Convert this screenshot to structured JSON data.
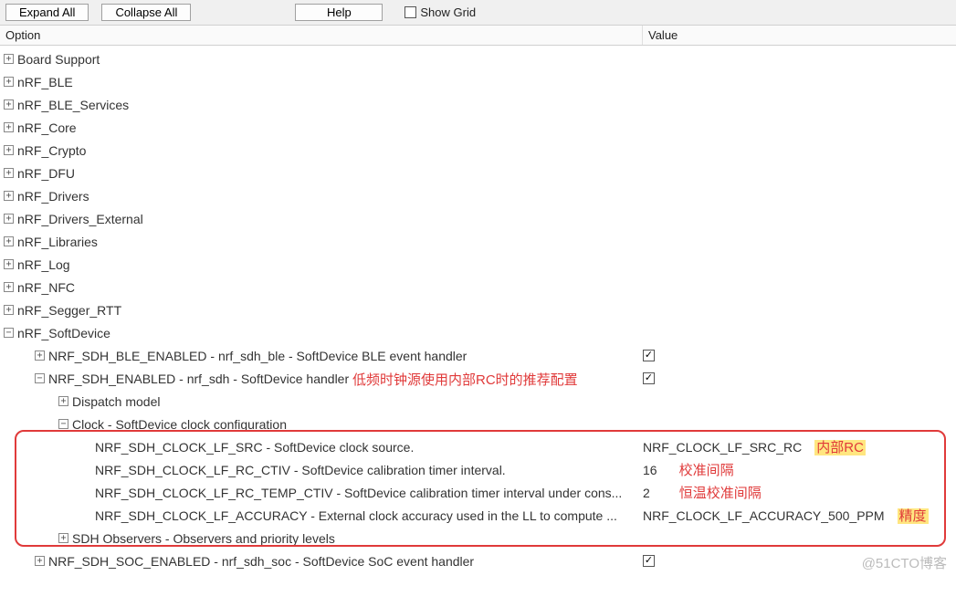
{
  "toolbar": {
    "expand_all": "Expand All",
    "collapse_all": "Collapse All",
    "help": "Help",
    "show_grid": "Show Grid"
  },
  "headers": {
    "option": "Option",
    "value": "Value"
  },
  "tree": {
    "board_support": "Board Support",
    "nrf_ble": "nRF_BLE",
    "nrf_ble_services": "nRF_BLE_Services",
    "nrf_core": "nRF_Core",
    "nrf_crypto": "nRF_Crypto",
    "nrf_dfu": "nRF_DFU",
    "nrf_drivers": "nRF_Drivers",
    "nrf_drivers_external": "nRF_Drivers_External",
    "nrf_libraries": "nRF_Libraries",
    "nrf_log": "nRF_Log",
    "nrf_nfc": "nRF_NFC",
    "nrf_segger_rtt": "nRF_Segger_RTT",
    "nrf_softdevice": "nRF_SoftDevice",
    "sdh_ble_enabled": "NRF_SDH_BLE_ENABLED - nrf_sdh_ble - SoftDevice BLE event handler",
    "sdh_enabled": "NRF_SDH_ENABLED - nrf_sdh - SoftDevice handler",
    "dispatch_model": "Dispatch model",
    "clock_cfg": "Clock - SoftDevice clock configuration",
    "clk_src": "NRF_SDH_CLOCK_LF_SRC  - SoftDevice clock source.",
    "clk_rc_ctiv": "NRF_SDH_CLOCK_LF_RC_CTIV - SoftDevice calibration timer interval.",
    "clk_rc_temp_ctiv": "NRF_SDH_CLOCK_LF_RC_TEMP_CTIV - SoftDevice calibration timer interval under cons...",
    "clk_accuracy": "NRF_SDH_CLOCK_LF_ACCURACY  - External clock accuracy used in the LL to compute ...",
    "sdh_observers": "SDH Observers - Observers and priority levels",
    "sdh_soc_enabled": "NRF_SDH_SOC_ENABLED - nrf_sdh_soc - SoftDevice SoC event handler"
  },
  "values": {
    "clk_src": "NRF_CLOCK_LF_SRC_RC",
    "clk_rc_ctiv": "16",
    "clk_rc_temp_ctiv": "2",
    "clk_accuracy": "NRF_CLOCK_LF_ACCURACY_500_PPM"
  },
  "annotations": {
    "header": "低频时钟源使用内部RC时的推荐配置",
    "a1": "内部RC",
    "a2": "校准间隔",
    "a3": "恒温校准间隔",
    "a4": "精度"
  },
  "watermark": "@51CTO博客"
}
